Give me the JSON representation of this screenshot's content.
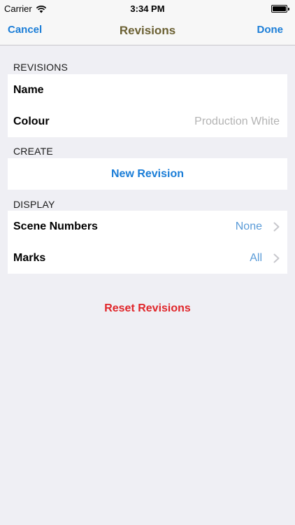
{
  "status_bar": {
    "carrier": "Carrier",
    "time": "3:34 PM"
  },
  "nav": {
    "cancel_label": "Cancel",
    "title": "Revisions",
    "done_label": "Done"
  },
  "sections": {
    "revisions": {
      "header": "REVISIONS",
      "name_label": "Name",
      "colour_label": "Colour",
      "colour_value": "Production White"
    },
    "create": {
      "header": "CREATE",
      "new_revision_label": "New Revision"
    },
    "display": {
      "header": "DISPLAY",
      "scene_numbers_label": "Scene Numbers",
      "scene_numbers_value": "None",
      "marks_label": "Marks",
      "marks_value": "All"
    }
  },
  "reset_label": "Reset Revisions",
  "colors": {
    "accent": "#1a7dd7",
    "title": "#6b6033",
    "destructive": "#e0262a",
    "value_blue": "#5a9bd8",
    "placeholder_gray": "#b3b3b3",
    "background": "#efeff4"
  }
}
